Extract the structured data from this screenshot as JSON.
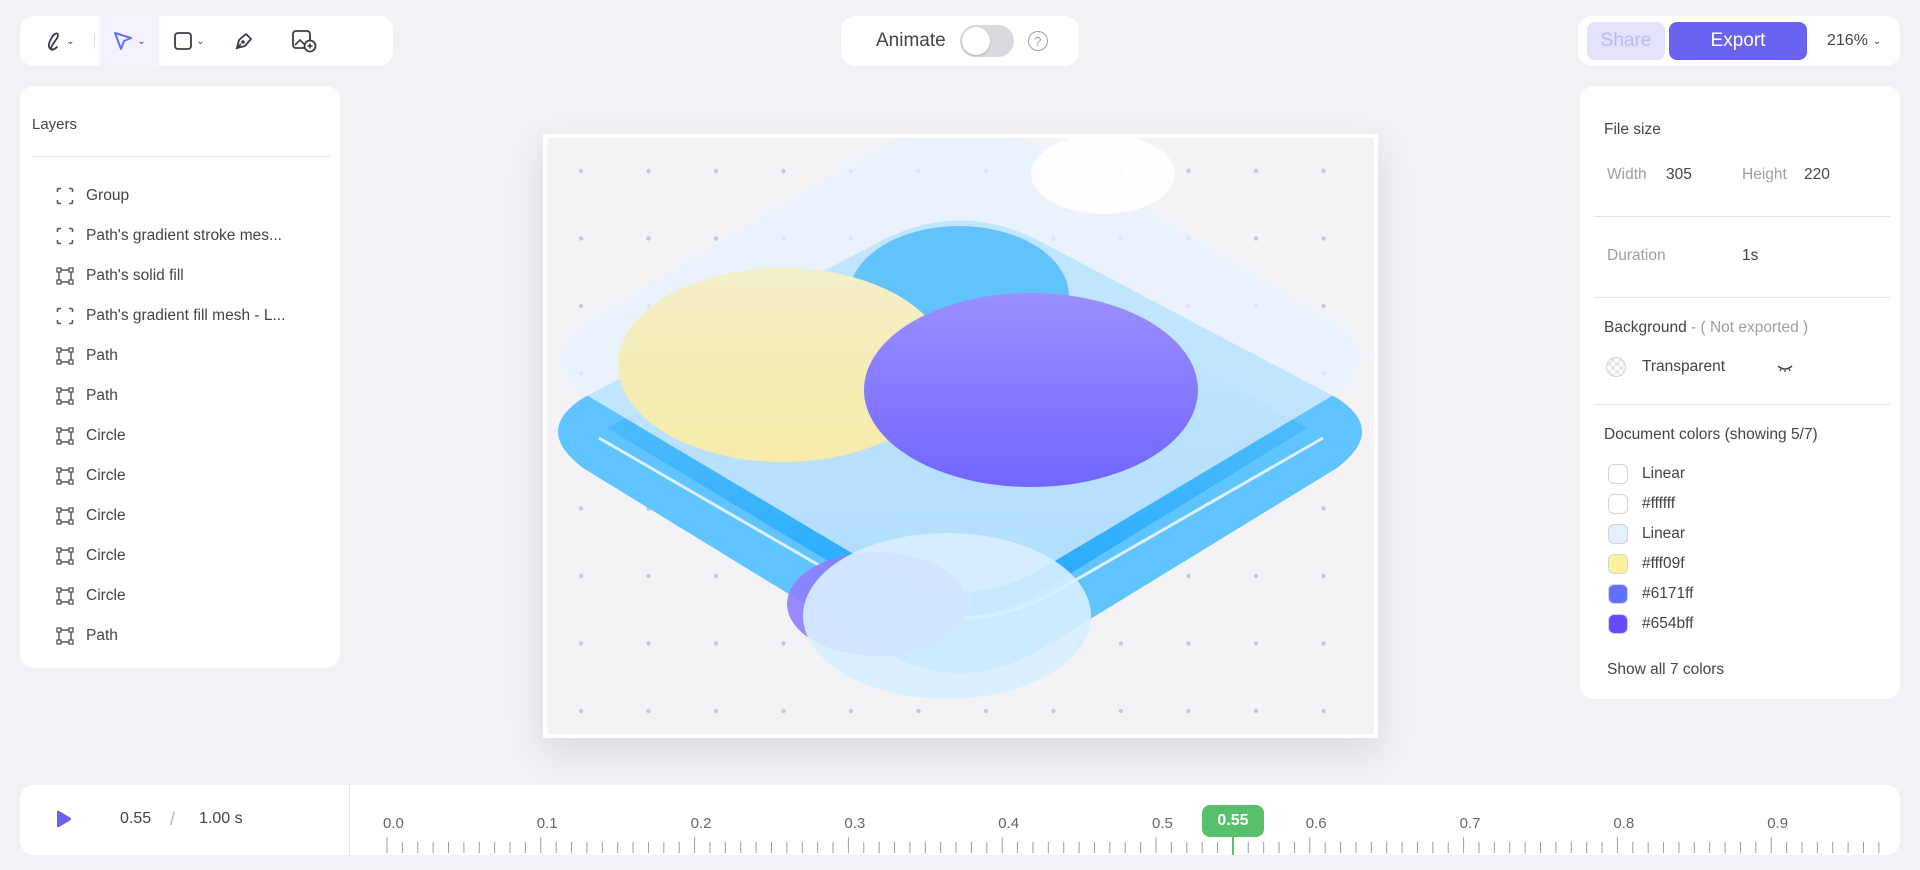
{
  "toolbar": {
    "tools": [
      "pencil-tool",
      "pointer-tool",
      "shape-tool",
      "pen-tool",
      "add-image-tool"
    ]
  },
  "animate": {
    "label": "Animate",
    "enabled": false,
    "help": "?"
  },
  "header": {
    "share_label": "Share",
    "export_label": "Export",
    "zoom": "216%"
  },
  "layers": {
    "title": "Layers",
    "items": [
      {
        "label": "Group",
        "icon": "group-icon"
      },
      {
        "label": "Path's gradient stroke mes...",
        "icon": "group-icon"
      },
      {
        "label": "Path's solid fill",
        "icon": "path-icon"
      },
      {
        "label": "Path's gradient fill mesh - L...",
        "icon": "group-icon"
      },
      {
        "label": "Path",
        "icon": "path-icon"
      },
      {
        "label": "Path",
        "icon": "path-icon"
      },
      {
        "label": "Circle",
        "icon": "path-icon"
      },
      {
        "label": "Circle",
        "icon": "path-icon"
      },
      {
        "label": "Circle",
        "icon": "path-icon"
      },
      {
        "label": "Circle",
        "icon": "path-icon"
      },
      {
        "label": "Circle",
        "icon": "path-icon"
      },
      {
        "label": "Path",
        "icon": "path-icon"
      }
    ]
  },
  "properties": {
    "file_size_title": "File size",
    "width_label": "Width",
    "width_value": "305",
    "height_label": "Height",
    "height_value": "220",
    "duration_label": "Duration",
    "duration_value": "1s",
    "background_title": "Background",
    "background_note": "- ( Not exported )",
    "background_value": "Transparent",
    "doc_colors_title": "Document colors (showing 5/7)",
    "colors": [
      {
        "label": "Linear",
        "color": "#ffffff"
      },
      {
        "label": "#ffffff",
        "color": "#ffffff"
      },
      {
        "label": "Linear",
        "color": "#e3f0fd"
      },
      {
        "label": "#fff09f",
        "color": "#fff09f"
      },
      {
        "label": "#6171ff",
        "color": "#6171ff"
      },
      {
        "label": "#654bff",
        "color": "#654bff"
      }
    ],
    "show_all_label": "Show all 7 colors"
  },
  "timeline": {
    "current": "0.55",
    "separator": "/",
    "total": "1.00 s",
    "ticks": [
      "0.0",
      "0.1",
      "0.2",
      "0.3",
      "0.4",
      "0.5",
      "0.6",
      "0.7",
      "0.8",
      "0.9"
    ],
    "playhead_label": "0.55",
    "playhead_value": 0.55
  },
  "colors": {
    "accent": "#6a62f0",
    "playhead": "#57c06c",
    "share_disabled": "#e2e2fb"
  }
}
